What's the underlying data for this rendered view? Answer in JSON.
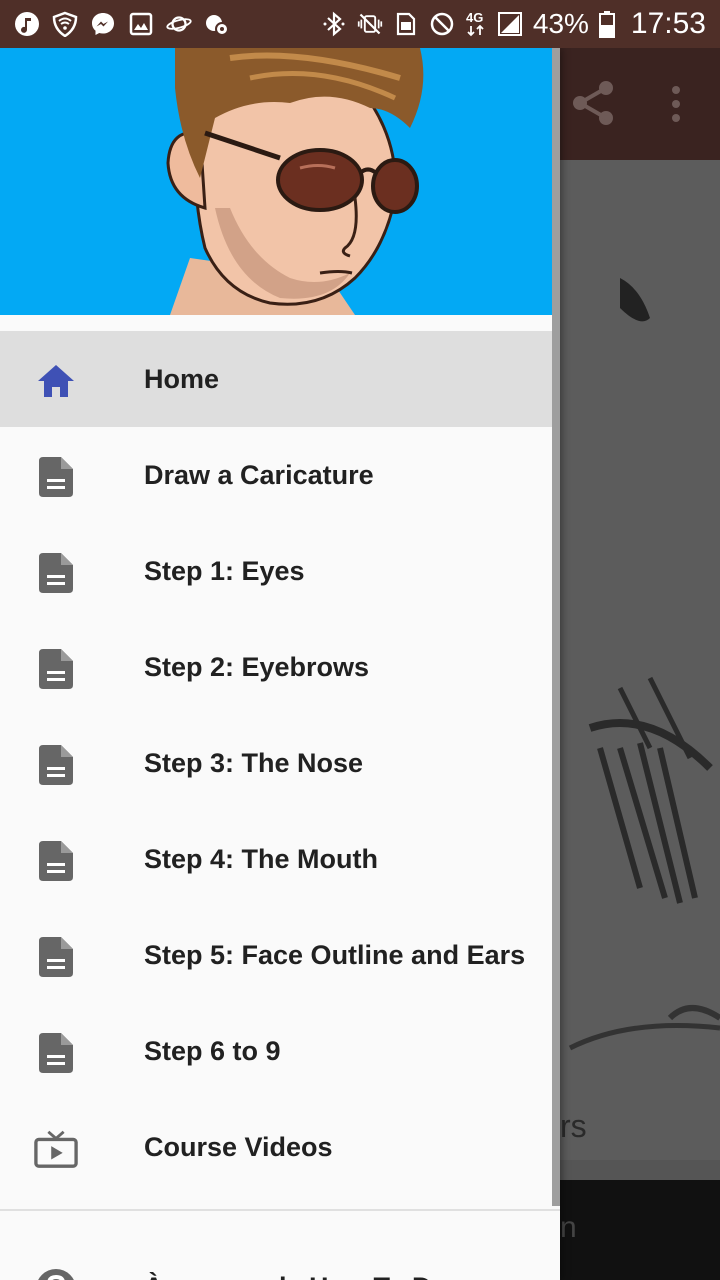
{
  "status_bar": {
    "left_icons": [
      "music-icon",
      "shield-wifi-icon",
      "messenger-icon",
      "image-icon",
      "planet-icon",
      "cloud-settings-icon"
    ],
    "right_icons": [
      "bluetooth-icon",
      "vibrate-off-icon",
      "sim-icon",
      "do-not-disturb-icon",
      "network-4g-icon",
      "signal-icon"
    ],
    "network_label": "4G",
    "battery": "43%",
    "time": "17:53"
  },
  "background_app": {
    "caption_fragment": "rs",
    "footer_fragment": "n"
  },
  "drawer": {
    "items": [
      {
        "label": "Home",
        "icon": "home-icon",
        "selected": true
      },
      {
        "label": "Draw a Caricature",
        "icon": "document-icon"
      },
      {
        "label": "Step 1: Eyes",
        "icon": "document-icon"
      },
      {
        "label": "Step 2: Eyebrows",
        "icon": "document-icon"
      },
      {
        "label": "Step 3: The Nose",
        "icon": "document-icon"
      },
      {
        "label": "Step 4: The Mouth",
        "icon": "document-icon"
      },
      {
        "label": "Step 5: Face Outline and Ears",
        "icon": "document-icon"
      },
      {
        "label": "Step 6 to 9",
        "icon": "document-icon"
      },
      {
        "label": "Course Videos",
        "icon": "tv-play-icon"
      }
    ],
    "about": {
      "label": "À propos de How To Draw a",
      "icon": "help-icon"
    }
  },
  "colors": {
    "status_bar": "#4f2f28",
    "header_bg": "#03a9f4",
    "home_icon": "#3f51b5",
    "doc_icon": "#666666",
    "selected_row": "#dedede"
  }
}
